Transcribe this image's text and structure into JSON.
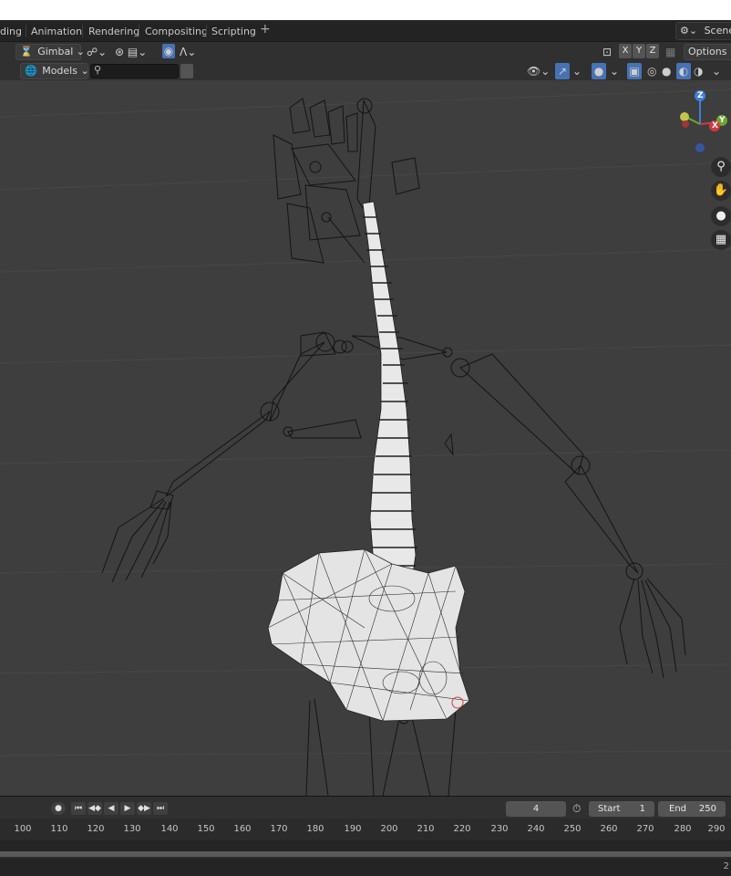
{
  "workspace_tabs": [
    "ding",
    "Animation",
    "Rendering",
    "Compositing",
    "Scripting"
  ],
  "add_workspace_label": "+",
  "scene_label": "Scene",
  "header": {
    "orientation_label": "Gimbal",
    "axis_x": "X",
    "axis_y": "Y",
    "axis_z": "Z",
    "options_label": "Options"
  },
  "viewport_header": {
    "filter_label": "Models",
    "search_placeholder": ""
  },
  "gizmo": {
    "z_label": "Z",
    "y_label": "Y",
    "x_label": "X",
    "colors": {
      "x": "#d6383e",
      "y": "#6ca82c",
      "z": "#3f7ee0"
    }
  },
  "nav_icons": [
    "zoom-icon",
    "pan-hand-icon",
    "camera-icon",
    "grid-icon"
  ],
  "timeline": {
    "current_frame": "4",
    "start_label": "Start",
    "start_value": "1",
    "end_label": "End",
    "end_value": "250",
    "ruler_ticks": [
      "100",
      "110",
      "120",
      "130",
      "140",
      "150",
      "160",
      "170",
      "180",
      "190",
      "200",
      "210",
      "220",
      "230",
      "240",
      "250",
      "260",
      "270",
      "280",
      "290"
    ]
  },
  "status": {
    "right_text": "2"
  },
  "colors": {
    "viewport_bg": "#3e3e3e",
    "accent_blue": "#4772b3",
    "mesh": "#e6e6e6"
  }
}
